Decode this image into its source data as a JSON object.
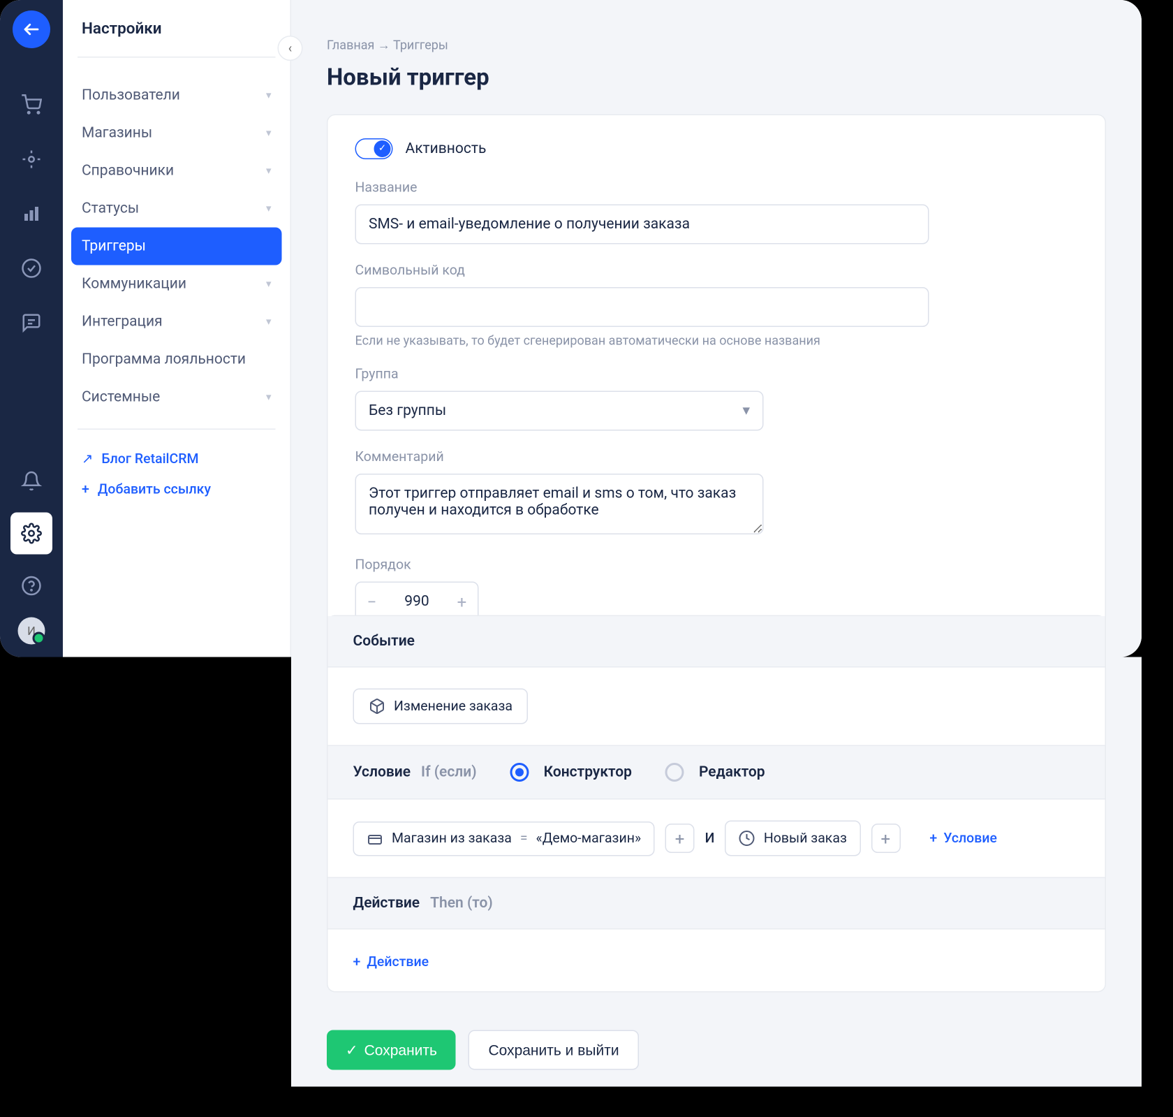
{
  "sidebar": {
    "title": "Настройки",
    "items": [
      {
        "label": "Пользователи",
        "expandable": true
      },
      {
        "label": "Магазины",
        "expandable": true
      },
      {
        "label": "Справочники",
        "expandable": true
      },
      {
        "label": "Статусы",
        "expandable": true
      },
      {
        "label": "Триггеры",
        "expandable": false,
        "active": true
      },
      {
        "label": "Коммуникации",
        "expandable": true
      },
      {
        "label": "Интеграция",
        "expandable": true
      },
      {
        "label": "Программа лояльности",
        "expandable": false
      },
      {
        "label": "Системные",
        "expandable": true
      }
    ],
    "links": [
      {
        "icon": "arrow-up-right",
        "label": "Блог RetailCRM"
      },
      {
        "icon": "plus",
        "label": "Добавить ссылку"
      }
    ]
  },
  "avatar_letter": "И",
  "breadcrumb": {
    "home": "Главная",
    "sep": "→",
    "current": "Триггеры"
  },
  "page_title": "Новый триггер",
  "activity": {
    "label": "Активность",
    "on": true
  },
  "fields": {
    "name": {
      "label": "Название",
      "value": "SMS- и email-уведомление о получении заказа"
    },
    "code": {
      "label": "Символьный код",
      "value": "",
      "hint": "Если не указывать, то будет сгенерирован автоматически на основе названия"
    },
    "group": {
      "label": "Группа",
      "value": "Без группы"
    },
    "comment": {
      "label": "Комментарий",
      "value": "Этот триггер отправляет email и sms о том, что заказ получен и находится в обработке"
    },
    "order": {
      "label": "Порядок",
      "value": "990"
    }
  },
  "event": {
    "title": "Событие",
    "chip": "Изменение заказа"
  },
  "condition": {
    "title": "Условие",
    "subtitle": "If (если)",
    "mode_constructor": "Конструктор",
    "mode_editor": "Редактор",
    "chip1_label": "Магазин из заказа",
    "chip1_op": "=",
    "chip1_val": "«Демо-магазин»",
    "and": "И",
    "chip2_label": "Новый заказ",
    "add_label": "Условие"
  },
  "action": {
    "title": "Действие",
    "subtitle": "Then (то)",
    "add_label": "Действие"
  },
  "buttons": {
    "save": "Сохранить",
    "save_exit": "Сохранить и выйти"
  }
}
